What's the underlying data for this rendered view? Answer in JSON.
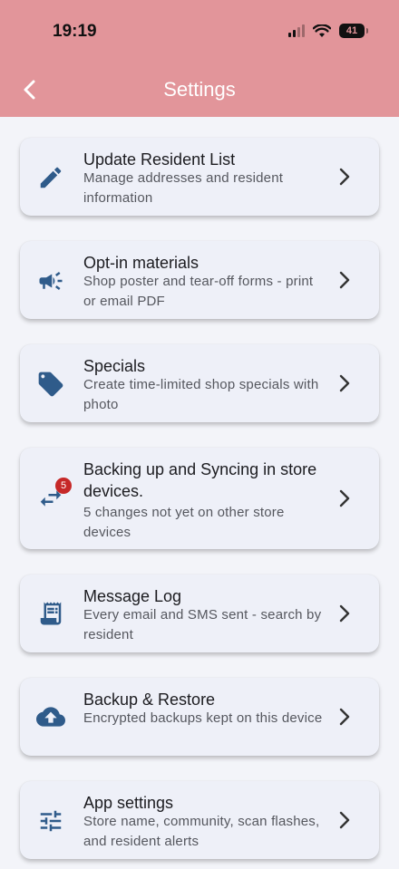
{
  "status_bar": {
    "time": "19:19",
    "battery": "41"
  },
  "header": {
    "title": "Settings"
  },
  "items": [
    {
      "title": "Update Resident List",
      "subtitle": "Manage addresses and resident information",
      "icon": "pencil-icon"
    },
    {
      "title": "Opt-in materials",
      "subtitle": "Shop poster and tear-off forms - print or email PDF",
      "icon": "megaphone-icon"
    },
    {
      "title": "Specials",
      "subtitle": "Create time-limited shop specials with photo",
      "icon": "tag-icon"
    },
    {
      "title": "Backing up and Syncing in store devices.",
      "subtitle": "5 changes not yet on other store devices",
      "icon": "sync-arrows-icon",
      "badge": "5"
    },
    {
      "title": "Message Log",
      "subtitle": "Every email and SMS sent - search by resident",
      "icon": "receipt-log-icon"
    },
    {
      "title": "Backup & Restore",
      "subtitle": "Encrypted backups kept on this device",
      "icon": "cloud-upload-icon"
    },
    {
      "title": "App settings",
      "subtitle": "Store name, community, scan flashes, and resident alerts",
      "icon": "sliders-icon"
    }
  ],
  "colors": {
    "header_bg": "#e2959a",
    "icon": "#2f5b8a",
    "card_bg": "#eef0f8",
    "badge": "#c62828"
  }
}
